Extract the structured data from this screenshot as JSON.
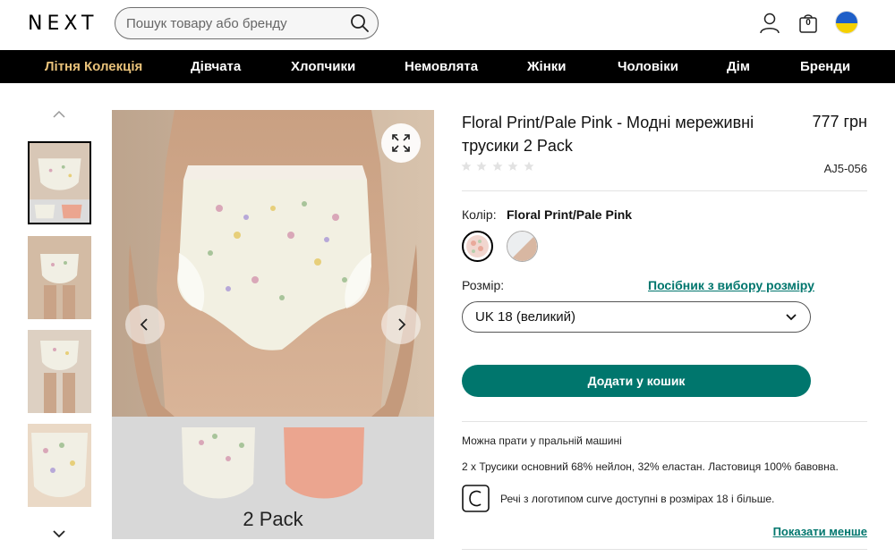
{
  "header": {
    "logo": "NEXT",
    "search_placeholder": "Пошук товару або бренду",
    "bag_count": "0",
    "icons": [
      "search-icon",
      "user-icon",
      "bag-icon",
      "ukraine-flag-icon"
    ]
  },
  "nav": {
    "items": [
      {
        "label": "Літня Колекція",
        "highlight": true
      },
      {
        "label": "Дівчата"
      },
      {
        "label": "Хлопчики"
      },
      {
        "label": "Немовлята"
      },
      {
        "label": "Жінки"
      },
      {
        "label": "Чоловіки"
      },
      {
        "label": "Дім"
      },
      {
        "label": "Бренди"
      }
    ],
    "highlight_color": "#e9c27a"
  },
  "gallery": {
    "pack_label": "2 Pack",
    "thumbnail_count": 4,
    "active_thumbnail": 1
  },
  "product": {
    "title": "Floral Print/Pale Pink - Модні мереживні трусики 2 Pack",
    "price": "777 грн",
    "rating": 0,
    "sku": "AJ5-056",
    "color_label": "Колір:",
    "color_value": "Floral Print/Pale Pink",
    "size_label": "Розмір:",
    "size_guide": "Посібник з вибору розміру",
    "size_value": "UK 18 (великий)",
    "add_to_cart": "Додати у кошик",
    "wash_info": "Можна прати у пральній машині",
    "composition": "2 x Трусики основний 68% нейлон, 32% еластан. Ластовиця 100% бавовна.",
    "curve_info": "Речі з логотипом curve доступні в розмірах 18 і більше.",
    "show_less": "Показати менше"
  },
  "colors": {
    "accent": "#00766d",
    "nav_bg": "#000000"
  }
}
